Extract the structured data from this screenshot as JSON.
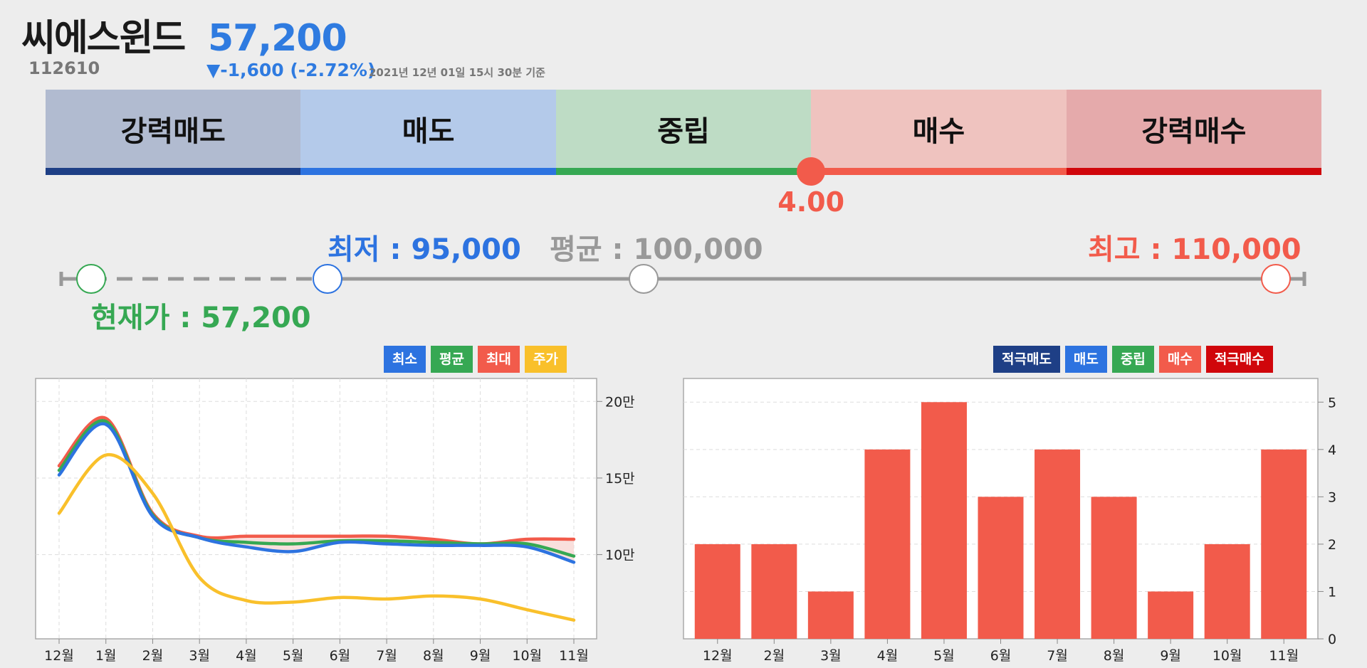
{
  "stock": {
    "name": "씨에스윈드",
    "price": "57,200",
    "code": "112610",
    "change": "▼-1,600 (-2.72%)",
    "timestamp": "2021년 12년 01일 15시 30분 기준"
  },
  "rating": {
    "segments": [
      {
        "label": "강력매도",
        "bg": "#b1bbd0",
        "line": "#1e3f86"
      },
      {
        "label": "매도",
        "bg": "#b4caea",
        "line": "#2d73e0"
      },
      {
        "label": "중립",
        "bg": "#bedcc5",
        "line": "#36a853"
      },
      {
        "label": "매수",
        "bg": "#efc3bf",
        "line": "#f25b4b"
      },
      {
        "label": "강력매수",
        "bg": "#e5aaab",
        "line": "#d0060b"
      }
    ],
    "value": "4.00",
    "score": 4.0
  },
  "target_range": {
    "low_label": "최저 : 95,000",
    "avg_label": "평균 : 100,000",
    "high_label": "최고 : 110,000",
    "current_label": "현재가 : 57,200",
    "low": 95000,
    "avg": 100000,
    "high": 110000,
    "current": 57200
  },
  "chart_data": [
    {
      "type": "line",
      "legend": [
        {
          "name": "최소",
          "color": "#2d73e0"
        },
        {
          "name": "평균",
          "color": "#36a853"
        },
        {
          "name": "최대",
          "color": "#f25b4b"
        },
        {
          "name": "주가",
          "color": "#f9c02b"
        }
      ],
      "categories": [
        "12월",
        "1월",
        "2월",
        "3월",
        "4월",
        "5월",
        "6월",
        "7월",
        "8월",
        "9월",
        "10월",
        "11월"
      ],
      "yticks": [
        "20만",
        "15만",
        "10만"
      ],
      "ylim": [
        45000,
        215000
      ],
      "grid": true,
      "series": [
        {
          "name": "최소",
          "color": "#2d73e0",
          "values": [
            152000,
            185000,
            125000,
            111000,
            105000,
            102000,
            108000,
            107000,
            106000,
            106000,
            105000,
            95000
          ]
        },
        {
          "name": "평균",
          "color": "#36a853",
          "values": [
            155000,
            187000,
            126000,
            111000,
            108000,
            107000,
            109000,
            109000,
            108000,
            107000,
            107000,
            99000
          ]
        },
        {
          "name": "최대",
          "color": "#f25b4b",
          "values": [
            158000,
            189000,
            127000,
            112000,
            112000,
            112000,
            112000,
            112000,
            110000,
            107000,
            110000,
            110000
          ]
        },
        {
          "name": "주가",
          "color": "#f9c02b",
          "values": [
            127000,
            165000,
            140000,
            85000,
            70000,
            69000,
            72000,
            71000,
            73000,
            71000,
            64000,
            57200
          ]
        }
      ]
    },
    {
      "type": "bar",
      "legend": [
        {
          "name": "적극매도",
          "color": "#1e3f86"
        },
        {
          "name": "매도",
          "color": "#2d73e0"
        },
        {
          "name": "중립",
          "color": "#36a853"
        },
        {
          "name": "매수",
          "color": "#f25b4b"
        },
        {
          "name": "적극매수",
          "color": "#d0060b"
        }
      ],
      "categories": [
        "12월",
        "2월",
        "3월",
        "4월",
        "5월",
        "6월",
        "7월",
        "8월",
        "9월",
        "10월",
        "11월"
      ],
      "values": [
        2,
        2,
        1,
        4,
        5,
        3,
        4,
        3,
        1,
        2,
        4
      ],
      "bar_color": "#f25b4b",
      "yticks": [
        0,
        1,
        2,
        3,
        4,
        5
      ],
      "ylim": [
        0,
        5.5
      ],
      "grid": true
    }
  ]
}
